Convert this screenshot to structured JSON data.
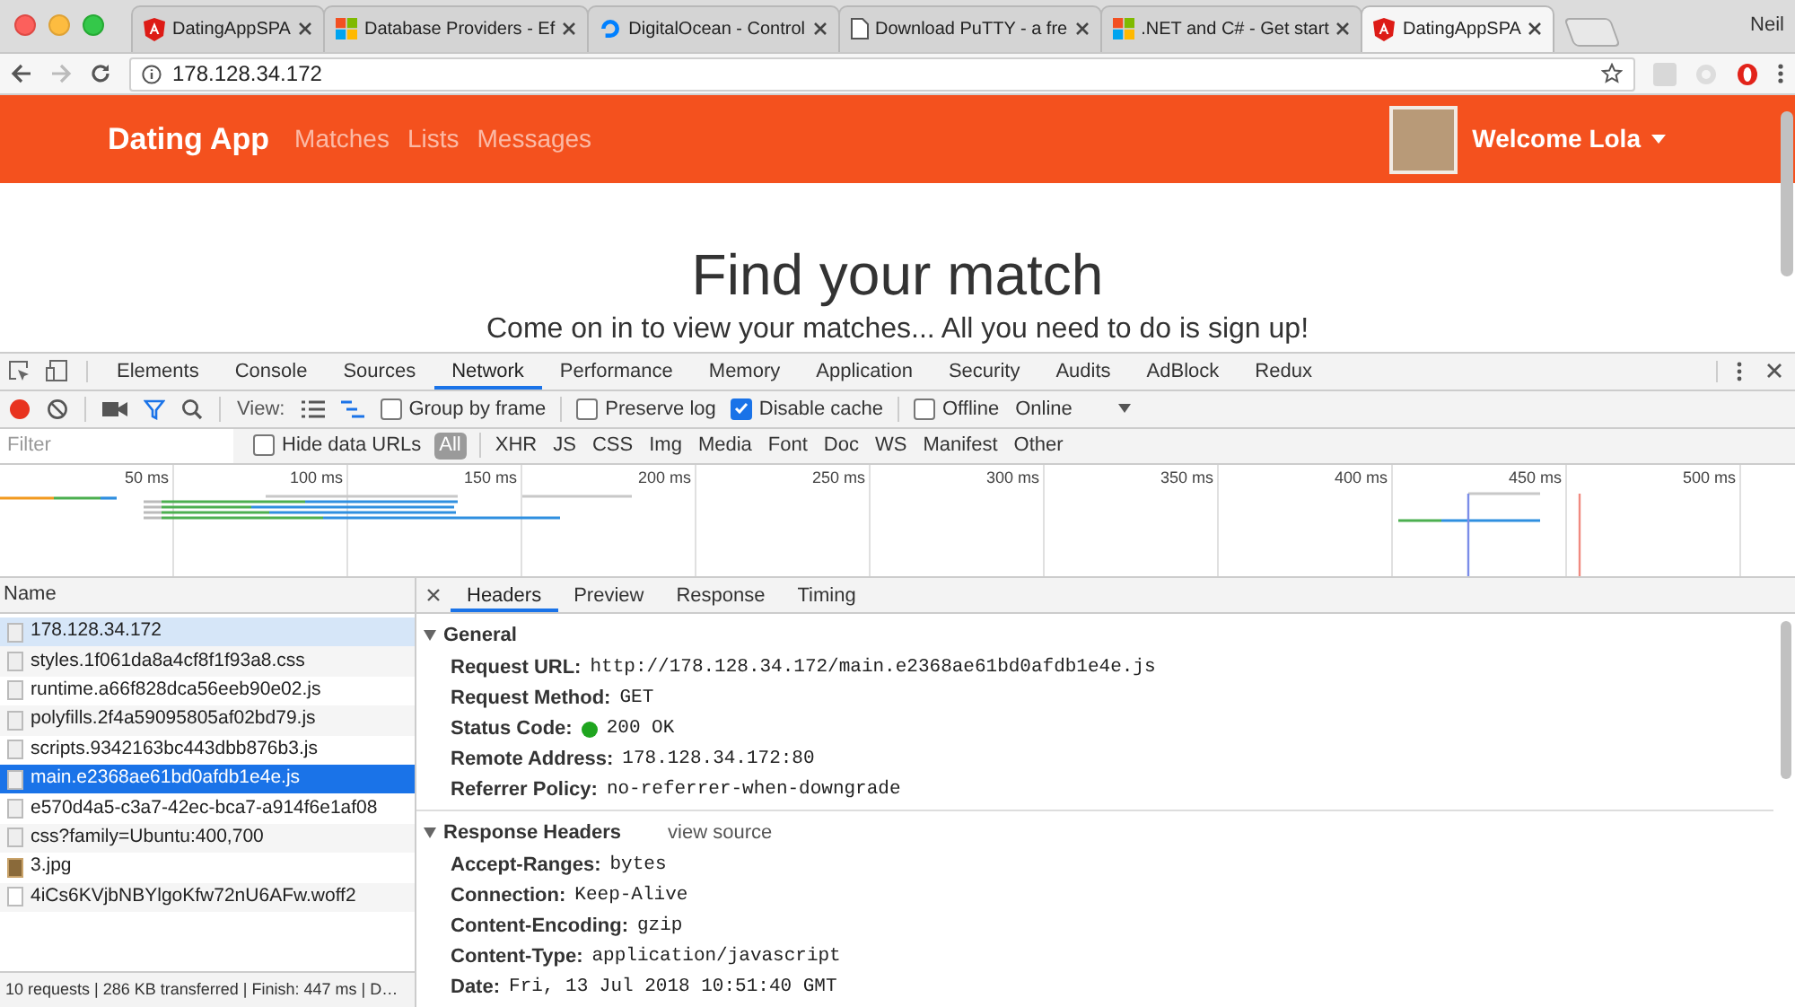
{
  "browser": {
    "tabs": [
      {
        "title": "DatingAppSPA",
        "kind": "shield",
        "selected": false
      },
      {
        "title": "Database Providers - Ef",
        "kind": "squares",
        "selected": false
      },
      {
        "title": "DigitalOcean - Control",
        "kind": "ring",
        "selected": false
      },
      {
        "title": "Download PuTTY - a fre",
        "kind": "page",
        "selected": false
      },
      {
        "title": ".NET and C# - Get start",
        "kind": "squares",
        "selected": false
      },
      {
        "title": "DatingAppSPA",
        "kind": "shield",
        "selected": true
      }
    ],
    "profile": "Neil",
    "url": "178.128.34.172"
  },
  "app": {
    "brand": "Dating App",
    "nav": [
      "Matches",
      "Lists",
      "Messages"
    ],
    "greeting": "Welcome Lola",
    "hero_title": "Find your match",
    "hero_subtitle": "Come on in to view your matches... All you need to do is sign up!"
  },
  "devtools": {
    "tabs": [
      {
        "label": "Elements",
        "selected": false
      },
      {
        "label": "Console",
        "selected": false
      },
      {
        "label": "Sources",
        "selected": false
      },
      {
        "label": "Network",
        "selected": true
      },
      {
        "label": "Performance",
        "selected": false
      },
      {
        "label": "Memory",
        "selected": false
      },
      {
        "label": "Application",
        "selected": false
      },
      {
        "label": "Security",
        "selected": false
      },
      {
        "label": "Audits",
        "selected": false
      },
      {
        "label": "AdBlock",
        "selected": false
      },
      {
        "label": "Redux",
        "selected": false
      }
    ],
    "toolbar": {
      "view_label": "View:",
      "options": [
        {
          "label": "Group by frame",
          "checked": false
        },
        {
          "label": "Preserve log",
          "checked": false
        },
        {
          "label": "Disable cache",
          "checked": true
        },
        {
          "label": "Offline",
          "checked": false
        }
      ],
      "throttle": "Online"
    },
    "filter": {
      "placeholder": "Filter",
      "hide_data_urls": {
        "label": "Hide data URLs",
        "checked": false
      },
      "types": [
        {
          "label": "All",
          "selected": true
        },
        {
          "label": "XHR",
          "selected": false
        },
        {
          "label": "JS",
          "selected": false
        },
        {
          "label": "CSS",
          "selected": false
        },
        {
          "label": "Img",
          "selected": false
        },
        {
          "label": "Media",
          "selected": false
        },
        {
          "label": "Font",
          "selected": false
        },
        {
          "label": "Doc",
          "selected": false
        },
        {
          "label": "WS",
          "selected": false
        },
        {
          "label": "Manifest",
          "selected": false
        },
        {
          "label": "Other",
          "selected": false
        }
      ]
    },
    "overview": {
      "ticks": [
        "50 ms",
        "100 ms",
        "150 ms",
        "200 ms",
        "250 ms",
        "300 ms",
        "350 ms",
        "400 ms",
        "450 ms",
        "500 ms"
      ]
    },
    "requests": {
      "column": "Name",
      "rows": [
        {
          "name": "178.128.34.172",
          "kind": "file",
          "selected": false,
          "hovered": true
        },
        {
          "name": "styles.1f061da8a4cf8f1f93a8.css",
          "kind": "file",
          "selected": false,
          "hovered": false
        },
        {
          "name": "runtime.a66f828dca56eeb90e02.js",
          "kind": "file",
          "selected": false,
          "hovered": false
        },
        {
          "name": "polyfills.2f4a59095805af02bd79.js",
          "kind": "file",
          "selected": false,
          "hovered": false
        },
        {
          "name": "scripts.9342163bc443dbb876b3.js",
          "kind": "file",
          "selected": false,
          "hovered": false
        },
        {
          "name": "main.e2368ae61bd0afdb1e4e.js",
          "kind": "file",
          "selected": true,
          "hovered": false
        },
        {
          "name": "e570d4a5-c3a7-42ec-bca7-a914f6e1af08",
          "kind": "file",
          "selected": false,
          "hovered": false
        },
        {
          "name": "css?family=Ubuntu:400,700",
          "kind": "file",
          "selected": false,
          "hovered": false
        },
        {
          "name": "3.jpg",
          "kind": "image",
          "selected": false,
          "hovered": false
        },
        {
          "name": "4iCs6KVjbNBYlgoKfw72nU6AFw.woff2",
          "kind": "blank",
          "selected": false,
          "hovered": false
        }
      ]
    },
    "status_bar": "10 requests | 286 KB transferred | Finish: 447 ms | D…",
    "details": {
      "tabs": [
        {
          "label": "Headers",
          "selected": true
        },
        {
          "label": "Preview",
          "selected": false
        },
        {
          "label": "Response",
          "selected": false
        },
        {
          "label": "Timing",
          "selected": false
        }
      ],
      "sections": [
        {
          "title": "General",
          "expanded": true,
          "fields": [
            {
              "label": "Request URL:",
              "value": "http://178.128.34.172/main.e2368ae61bd0afdb1e4e.js"
            },
            {
              "label": "Request Method:",
              "value": "GET"
            },
            {
              "label": "Status Code:",
              "value": "200 OK",
              "color": "#1fa51f"
            },
            {
              "label": "Remote Address:",
              "value": "178.128.34.172:80"
            },
            {
              "label": "Referrer Policy:",
              "value": "no-referrer-when-downgrade"
            }
          ]
        },
        {
          "title": "Response Headers",
          "expanded": true,
          "link": "view source",
          "fields": [
            {
              "label": "Accept-Ranges:",
              "value": "bytes"
            },
            {
              "label": "Connection:",
              "value": "Keep-Alive"
            },
            {
              "label": "Content-Encoding:",
              "value": "gzip"
            },
            {
              "label": "Content-Type:",
              "value": "application/javascript"
            },
            {
              "label": "Date:",
              "value": "Fri, 13 Jul 2018 10:51:40 GMT"
            }
          ]
        }
      ]
    }
  }
}
